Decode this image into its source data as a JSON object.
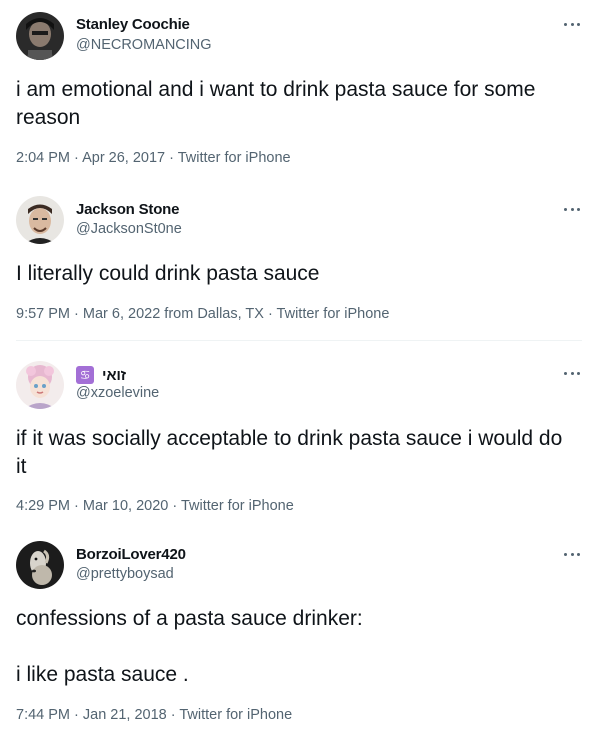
{
  "tweets": [
    {
      "name": "Stanley Coochie",
      "handle": "@NECROMANCING",
      "text": "i am emotional and i want to drink pasta sauce for some reason",
      "meta": "2:04 PM · Apr 26, 2017 · Twitter for iPhone",
      "avatar_icon": "profile-photo-icon"
    },
    {
      "name": "Jackson Stone",
      "handle": "@JacksonSt0ne",
      "text": "I literally could drink pasta sauce",
      "meta": "9:57 PM · Mar 6, 2022 from Dallas, TX · Twitter for iPhone",
      "avatar_icon": "profile-photo-icon"
    },
    {
      "name": "זואי",
      "name_badge": "♋",
      "handle": "@xzoelevine",
      "text": "if it was socially acceptable to drink pasta sauce i would do it",
      "meta": "4:29 PM · Mar 10, 2020 · Twitter for iPhone",
      "avatar_icon": "profile-illustration-icon"
    },
    {
      "name": "BorzoiLover420",
      "handle": "@prettyboysad",
      "text": "confessions of a pasta sauce drinker:\n\ni like pasta sauce .",
      "meta": "7:44 PM · Jan 21, 2018 · Twitter for iPhone",
      "avatar_icon": "borzoi-dog-photo-icon"
    }
  ],
  "colors": {
    "primary_text": "#0f1419",
    "secondary_text": "#536471",
    "divider": "#eff3f4",
    "badge": "#a36fd6"
  },
  "icons": {
    "more": "more-horizontal-icon"
  }
}
